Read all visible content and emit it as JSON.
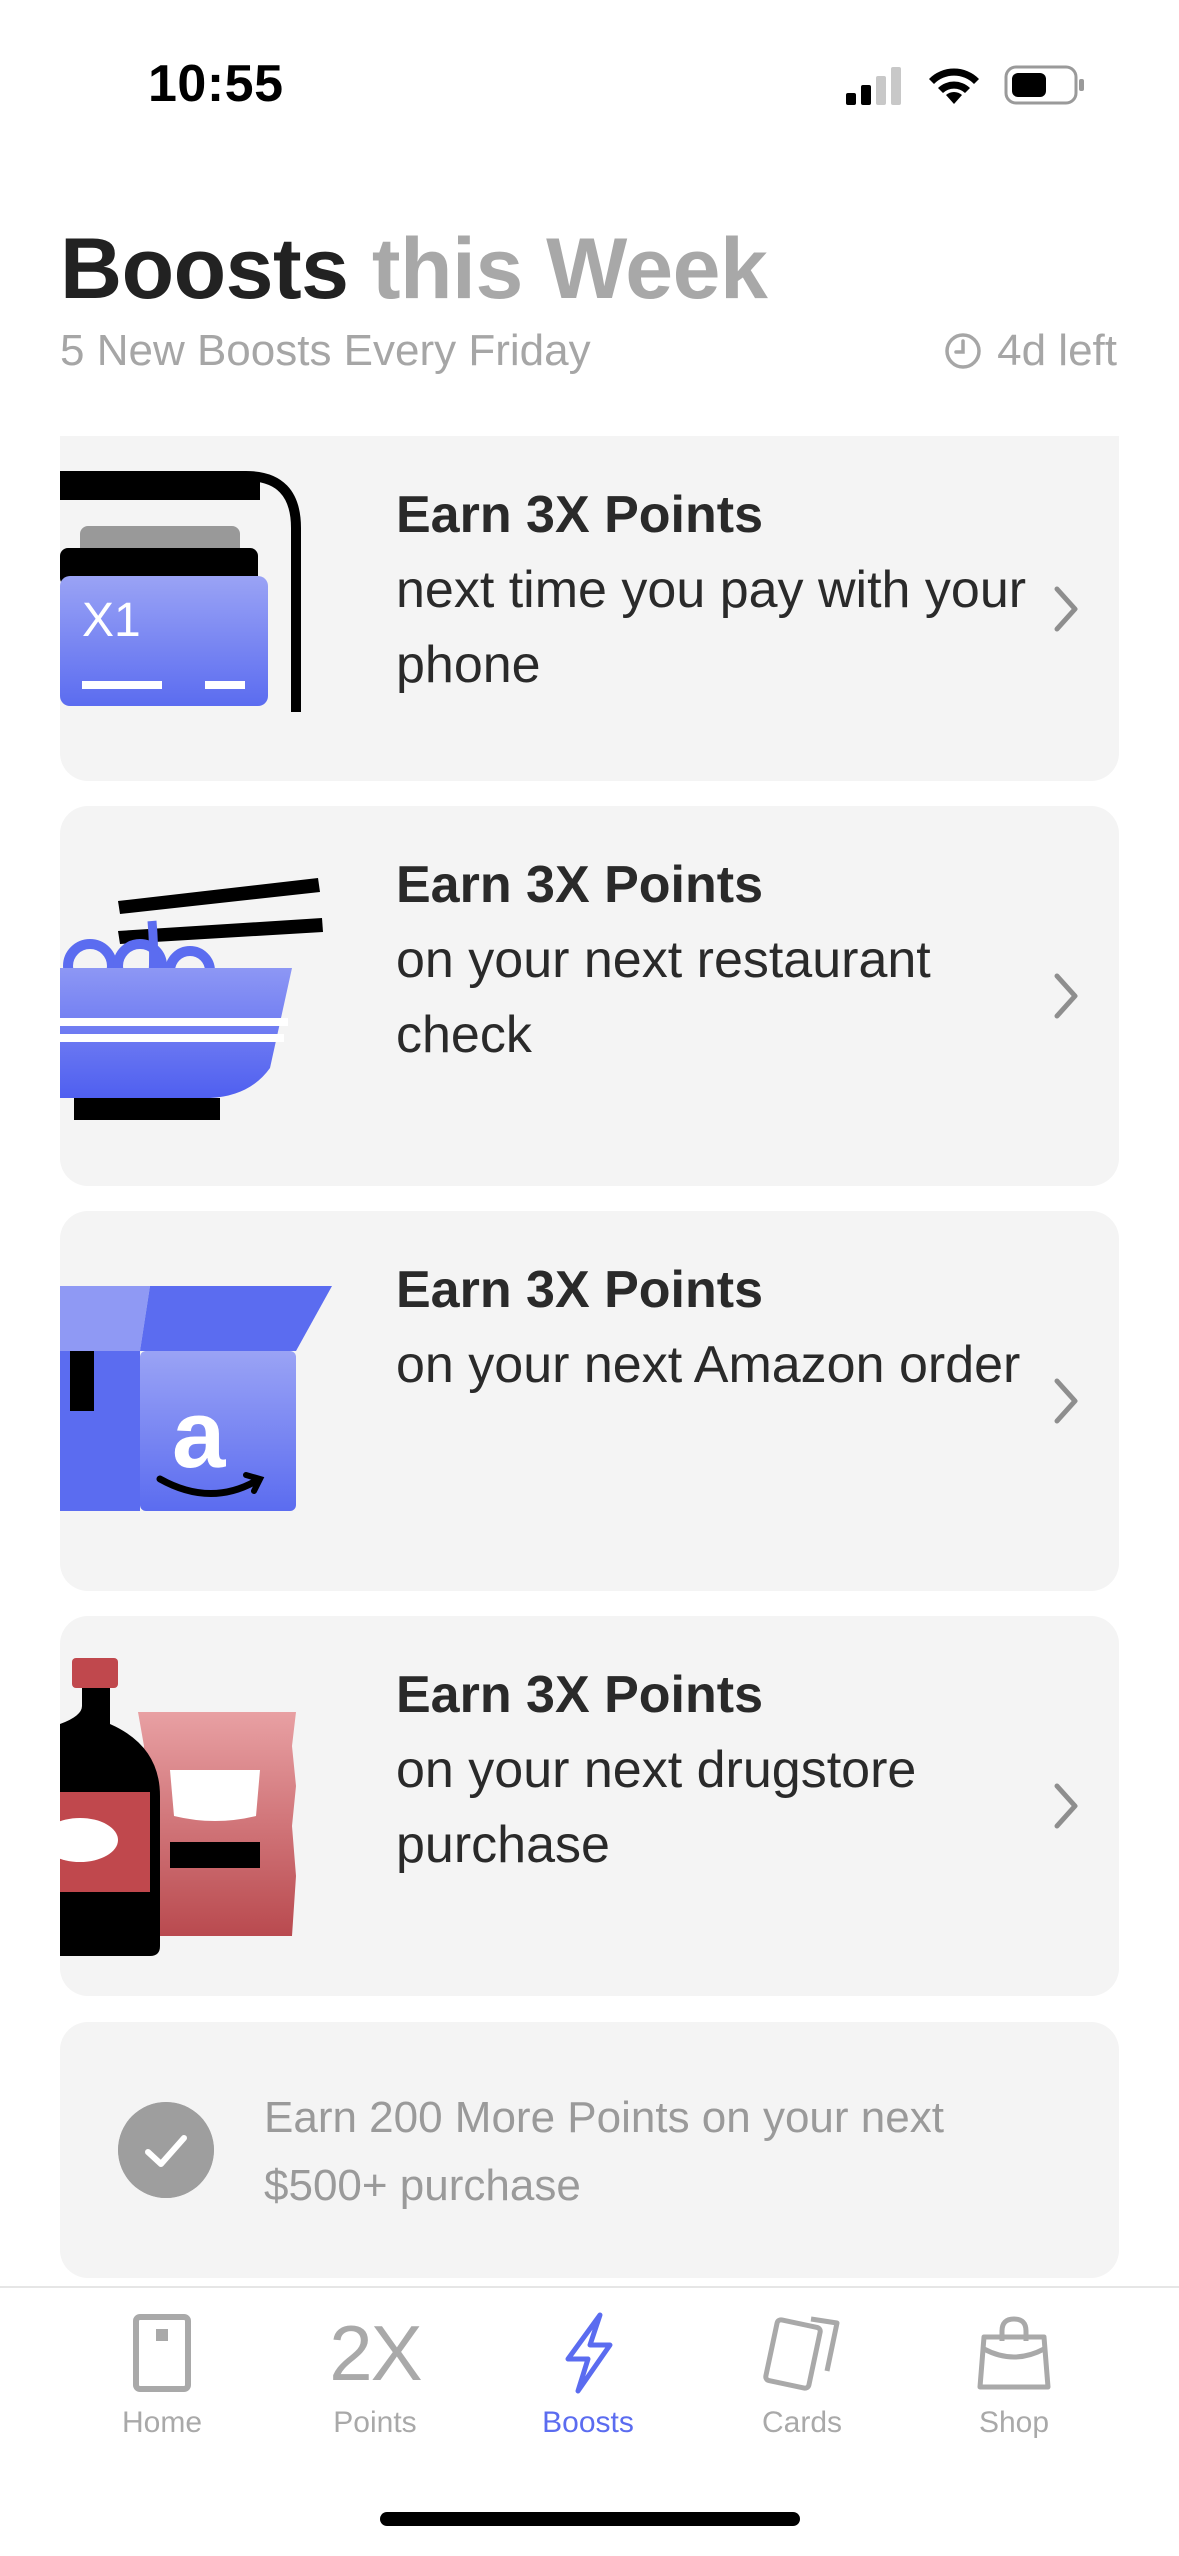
{
  "status_bar": {
    "time": "10:55"
  },
  "header": {
    "title_main": "Boosts",
    "title_suffix": "this Week",
    "subtitle": "5 New Boosts Every Friday",
    "time_left": "4d left"
  },
  "boosts": [
    {
      "headline": "Earn 3X Points",
      "detail": "next time you pay with your phone",
      "icon": "phone-pay-icon"
    },
    {
      "headline": "Earn 3X Points",
      "detail": "on your next restaurant check",
      "icon": "noodle-bowl-icon"
    },
    {
      "headline": "Earn 3X Points",
      "detail": "on your next Amazon order",
      "icon": "amazon-box-icon"
    },
    {
      "headline": "Earn 3X Points",
      "detail": "on your next drugstore purchase",
      "icon": "drugstore-items-icon"
    }
  ],
  "completed_boost": {
    "text": "Earn 200 More Points on your next $500+ purchase",
    "icon": "check-circle-icon"
  },
  "tabs": [
    {
      "label": "Home",
      "icon": "card-outline-icon"
    },
    {
      "label": "Points",
      "glyph": "2X"
    },
    {
      "label": "Boosts",
      "icon": "lightning-icon"
    },
    {
      "label": "Cards",
      "icon": "cards-stack-icon"
    },
    {
      "label": "Shop",
      "icon": "shopping-bag-icon"
    }
  ],
  "colors": {
    "accent": "#5b6cf0",
    "card_background": "#f4f4f4",
    "muted_text": "#a6a6a6"
  }
}
